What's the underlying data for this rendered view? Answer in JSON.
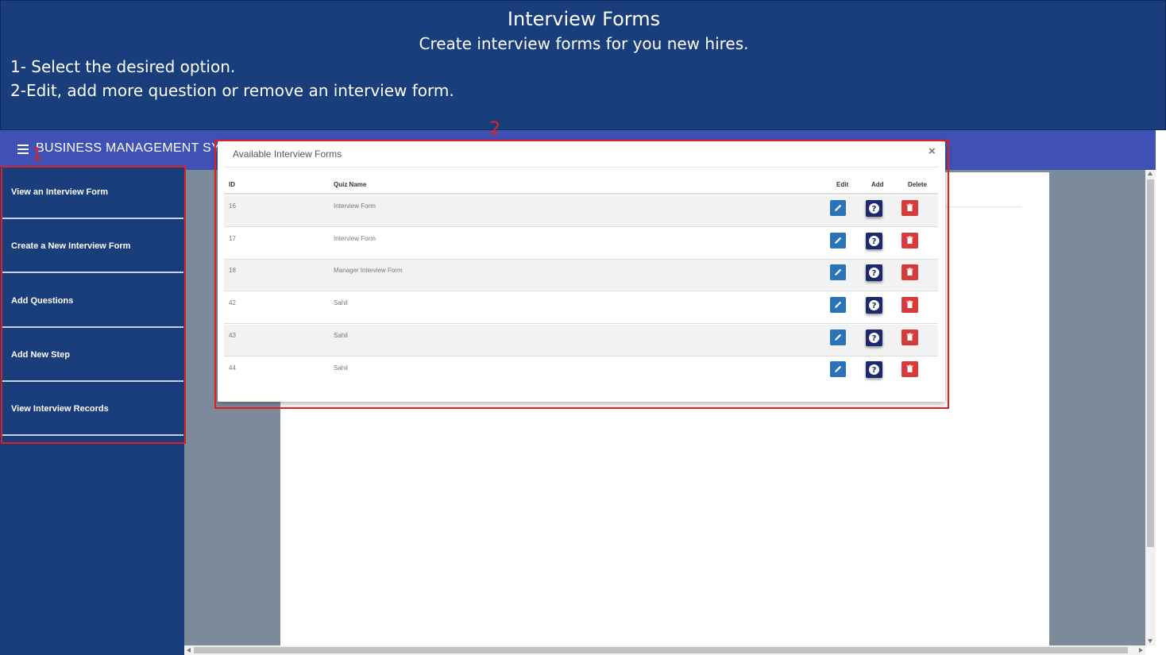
{
  "banner": {
    "title": "Interview Forms",
    "subtitle": "Create interview forms for you new hires.",
    "step1": "1- Select the desired option.",
    "step2": "2-Edit, add more question or remove an interview form."
  },
  "app": {
    "title": "BUSINESS MANAGEMENT SYS"
  },
  "sidebar": {
    "items": [
      {
        "label": "View an Interview Form"
      },
      {
        "label": "Create a New Interview Form"
      },
      {
        "label": "Add Questions"
      },
      {
        "label": "Add New Step"
      },
      {
        "label": "View Interview Records"
      }
    ]
  },
  "annotations": {
    "one": "1",
    "two": "2"
  },
  "modal": {
    "title": "Available Interview Forms",
    "close": "×",
    "headers": {
      "id": "ID",
      "name": "Quiz Name",
      "edit": "Edit",
      "add": "Add",
      "delete": "Delete"
    },
    "rows": [
      {
        "id": "16",
        "name": "Interview Form"
      },
      {
        "id": "17",
        "name": "Interview Form"
      },
      {
        "id": "18",
        "name": "Manager Interview Form"
      },
      {
        "id": "42",
        "name": "Sahil"
      },
      {
        "id": "43",
        "name": "Sahil"
      },
      {
        "id": "44",
        "name": "Sahil"
      }
    ]
  },
  "colors": {
    "banner": "#1a3d7c",
    "header": "#3f51b5",
    "edit": "#2a73b8",
    "add": "#1a2a6c",
    "delete": "#d63a3a",
    "annotation": "#e02020"
  }
}
